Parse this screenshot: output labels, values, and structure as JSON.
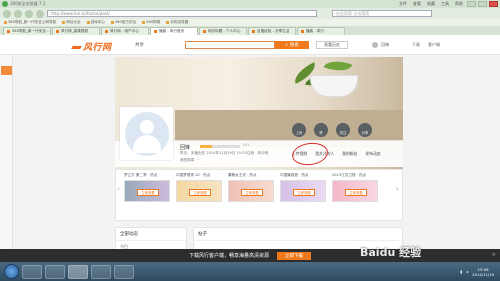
{
  "browser": {
    "title": "360安全浏览器 7.1",
    "menus": [
      "文件",
      "查看",
      "收藏",
      "工具",
      "帮助"
    ],
    "address": "http://www.fun.tv/home/post/",
    "search_placeholder": "在此搜索 点击搜索",
    "favorites": [
      "360导航_新一代安全上网导航",
      "网址大全",
      "游戏中心",
      "360官方论坛",
      "360购物",
      "手机浏览器"
    ],
    "tabs": [
      {
        "label": "360导航_新一代安全...",
        "active": false
      },
      {
        "label": "风行网_高清视频",
        "active": false
      },
      {
        "label": "风行网 - 用户中心",
        "active": false
      },
      {
        "label": "播客 - 风行首页",
        "active": true
      },
      {
        "label": "网页标题 - 个人中心",
        "active": false
      },
      {
        "label": "百度经验 - 分享生活",
        "active": false
      },
      {
        "label": "播客 - 风行",
        "active": false
      }
    ]
  },
  "site": {
    "brand": "风行网",
    "share_label": "共享",
    "search_button": "搜索",
    "history_label": "观看历史",
    "header_user": "回锋",
    "header_links": [
      "下载",
      "客户端"
    ]
  },
  "profile": {
    "name": "回锋",
    "level_text": "LV1",
    "level_fraction": 0.3,
    "register_info": "昨日，未播出任  2014年11月19日 15:53注册 · 风行网",
    "medal_info": "我的勋章 ···",
    "actions": [
      "上传",
      "赞",
      "关注",
      "分享"
    ],
    "tabs": [
      "上传视频",
      "我关注的人",
      "我的粉丝",
      "发布动态"
    ]
  },
  "cards": [
    {
      "title": "梦立方 第二季 · 热点",
      "button": "立即观看"
    },
    {
      "title": "中国梦想秀 20 · 热点",
      "button": "立即观看"
    },
    {
      "title": "暴跑女王农 · 热点",
      "button": "立即观看"
    },
    {
      "title": "中国最强音 · 热点",
      "button": "立即观看"
    },
    {
      "title": "2013江苏卫视 · 热点",
      "button": "立即观看"
    }
  ],
  "sections": {
    "left_title": "全部动态",
    "left_sub": "节目",
    "right_title": "帖子"
  },
  "promo": {
    "text": "下载风行客户端，畅享海量高清资源",
    "button": "立即下载"
  },
  "taskbar": {
    "time": "15:06",
    "date": "2014/11/19"
  },
  "watermark": "Baidu 经验",
  "colors": {
    "accent": "#f07a1b",
    "annotation": "#d32f2f"
  }
}
